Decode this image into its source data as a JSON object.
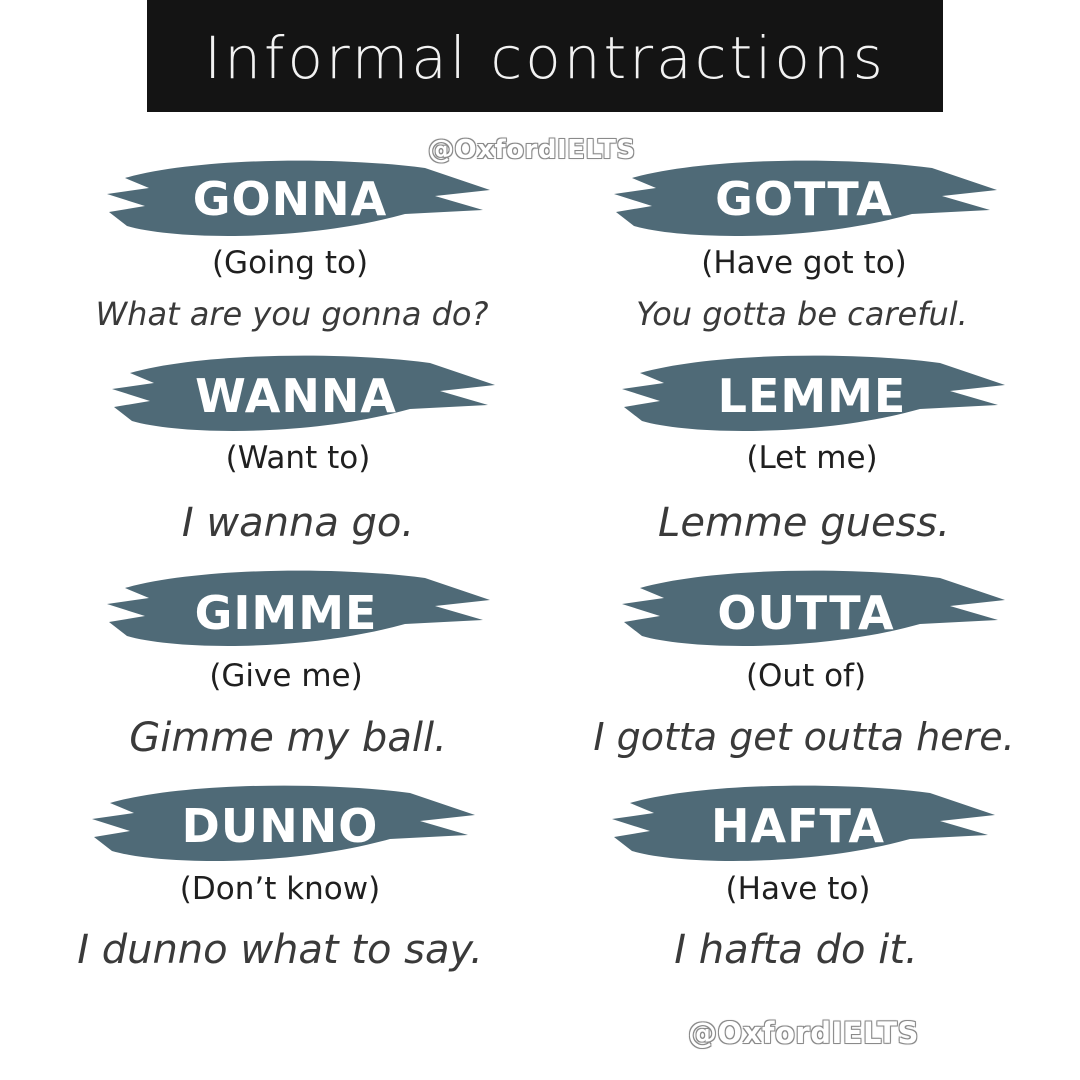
{
  "title": "Informal contractions",
  "watermark_top": "@OxfordIELTS",
  "watermark_bottom": "@OxfordIELTS",
  "colors": {
    "banner": "#141414",
    "brush": "#4f6a77",
    "text": "#2b2b2b"
  },
  "contractions": [
    {
      "word": "GONNA",
      "meaning": "(Going to)",
      "example": "What are you gonna do?"
    },
    {
      "word": "GOTTA",
      "meaning": "(Have got to)",
      "example": "You gotta be careful."
    },
    {
      "word": "WANNA",
      "meaning": "(Want to)",
      "example": "I wanna go."
    },
    {
      "word": "LEMME",
      "meaning": "(Let me)",
      "example": "Lemme guess."
    },
    {
      "word": "GIMME",
      "meaning": "(Give me)",
      "example": "Gimme my ball."
    },
    {
      "word": "OUTTA",
      "meaning": "(Out of)",
      "example": "I gotta get outta here."
    },
    {
      "word": "DUNNO",
      "meaning": "(Don’t know)",
      "example": "I dunno what to say."
    },
    {
      "word": "HAFTA",
      "meaning": "(Have to)",
      "example": "I hafta do it."
    }
  ]
}
